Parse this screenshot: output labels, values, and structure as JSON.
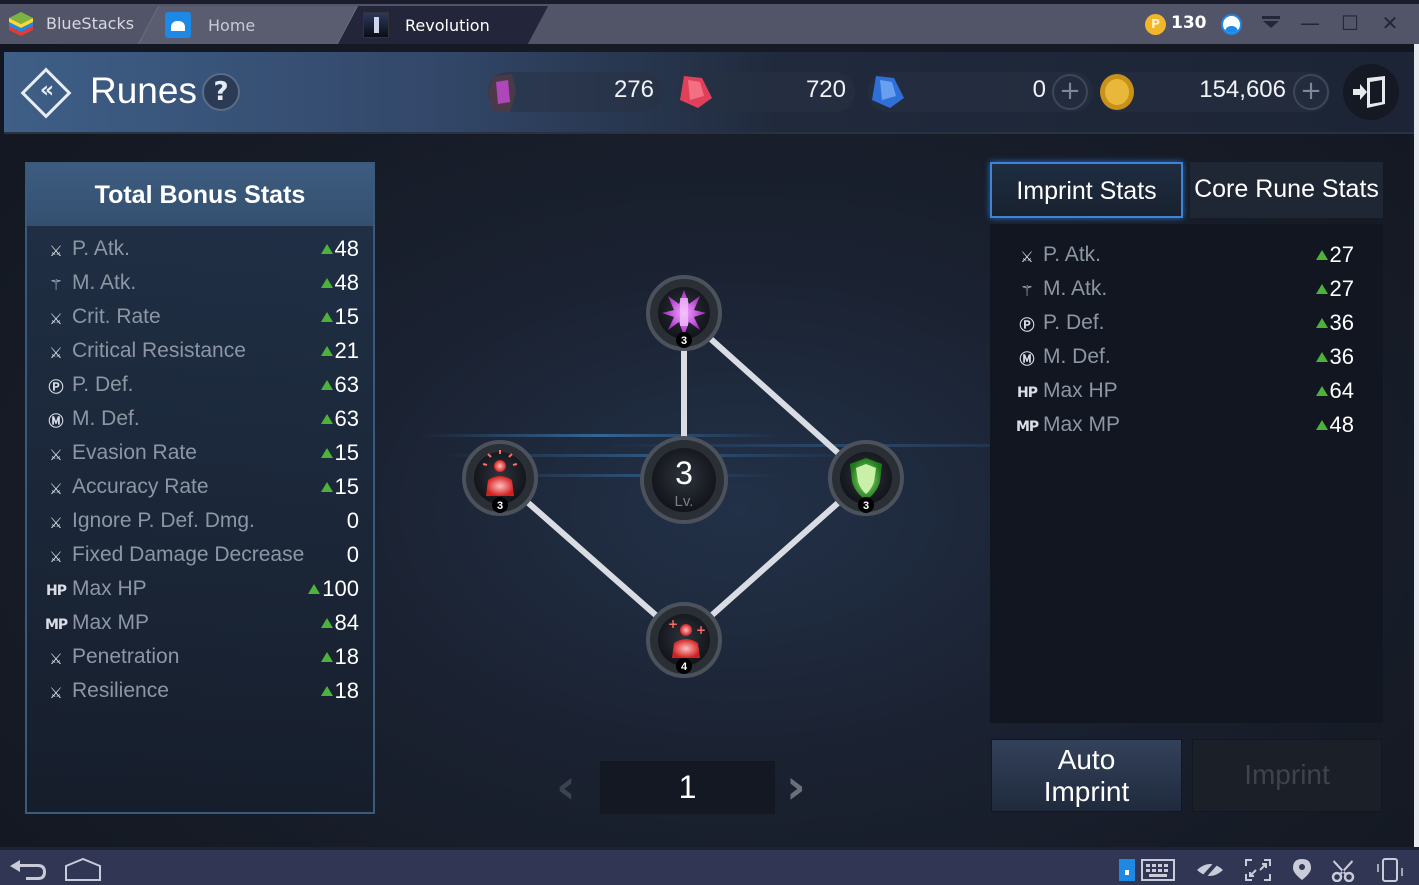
{
  "titlebar": {
    "app_name": "BlueStacks",
    "tabs": [
      {
        "label": "Home",
        "icon": "home-icon",
        "active": false
      },
      {
        "label": "Revolution",
        "icon": "game-icon",
        "active": true
      }
    ],
    "points_icon": "P",
    "points": "130",
    "window_controls": [
      "minimize",
      "maximize",
      "close"
    ],
    "minimize_glyph": "—",
    "maximize_glyph": "☐",
    "close_glyph": "✕"
  },
  "header": {
    "title": "Runes",
    "back_glyph": "«",
    "help_glyph": "?",
    "currencies": [
      {
        "name": "rune-stone",
        "value": "276",
        "color": "#c84bd8"
      },
      {
        "name": "red-gem",
        "value": "720",
        "color": "#e0405a"
      },
      {
        "name": "blue-gem",
        "value": "0",
        "color": "#3a7be0",
        "has_plus": true
      },
      {
        "name": "gold-coin",
        "value": "154,606",
        "color": "#d9a520",
        "has_plus": true
      }
    ],
    "plus_glyph": "+"
  },
  "total_bonus": {
    "title": "Total Bonus Stats",
    "stats": [
      {
        "icon": "⚔",
        "label": "P. Atk.",
        "value": "48",
        "up": true
      },
      {
        "icon": "⚚",
        "label": "M. Atk.",
        "value": "48",
        "up": true
      },
      {
        "icon": "⚔",
        "label": "Crit. Rate",
        "value": "15",
        "up": true
      },
      {
        "icon": "⚔",
        "label": "Critical Resistance",
        "value": "21",
        "up": true
      },
      {
        "icon": "Ⓟ",
        "label": "P. Def.",
        "value": "63",
        "up": true
      },
      {
        "icon": "Ⓜ",
        "label": "M. Def.",
        "value": "63",
        "up": true
      },
      {
        "icon": "⚔",
        "label": "Evasion Rate",
        "value": "15",
        "up": true
      },
      {
        "icon": "⚔",
        "label": "Accuracy Rate",
        "value": "15",
        "up": true
      },
      {
        "icon": "⚔",
        "label": "Ignore P. Def. Dmg.",
        "value": "0",
        "up": false
      },
      {
        "icon": "⚔",
        "label": "Fixed Damage Decrease",
        "value": "0",
        "up": false
      },
      {
        "icon": "HP",
        "label": "Max HP",
        "value": "100",
        "up": true
      },
      {
        "icon": "MP",
        "label": "Max MP",
        "value": "84",
        "up": true
      },
      {
        "icon": "⚔",
        "label": "Penetration",
        "value": "18",
        "up": true
      },
      {
        "icon": "⚔",
        "label": "Resilience",
        "value": "18",
        "up": true
      }
    ]
  },
  "rune_board": {
    "level": "3",
    "level_label": "Lv.",
    "nodes": [
      {
        "name": "top-rune",
        "type": "purple-crystal",
        "level": "3",
        "color": "#d04ee8"
      },
      {
        "name": "left-rune",
        "type": "red-body-glow",
        "level": "3",
        "color": "#e23b3b"
      },
      {
        "name": "right-rune",
        "type": "green-shield",
        "level": "3",
        "color": "#3fae3a"
      },
      {
        "name": "bottom-rune",
        "type": "red-body-plus",
        "level": "4",
        "color": "#e23b3b"
      }
    ]
  },
  "pager": {
    "prev_glyph": "‹",
    "next_glyph": "›",
    "page": "1"
  },
  "stats_tabs": [
    {
      "label": "Imprint Stats",
      "active": true
    },
    {
      "label": "Core Rune Stats",
      "active": false
    }
  ],
  "imprint_stats": [
    {
      "icon": "⚔",
      "label": "P. Atk.",
      "value": "27",
      "up": true
    },
    {
      "icon": "⚚",
      "label": "M. Atk.",
      "value": "27",
      "up": true
    },
    {
      "icon": "Ⓟ",
      "label": "P. Def.",
      "value": "36",
      "up": true
    },
    {
      "icon": "Ⓜ",
      "label": "M. Def.",
      "value": "36",
      "up": true
    },
    {
      "icon": "HP",
      "label": "Max HP",
      "value": "64",
      "up": true
    },
    {
      "icon": "MP",
      "label": "Max MP",
      "value": "48",
      "up": true
    }
  ],
  "actions": {
    "auto_imprint_line1": "Auto",
    "auto_imprint_line2": "Imprint",
    "imprint": "Imprint",
    "imprint_enabled": false
  },
  "navbar": {
    "left": [
      "back-icon",
      "home-icon"
    ],
    "right": [
      "phone-mode-icon",
      "keyboard-icon",
      "eye-off-icon",
      "fullscreen-icon",
      "location-icon",
      "scissors-icon",
      "shake-icon"
    ]
  },
  "colors": {
    "accent_blue": "#3f83d6",
    "stat_up_green": "#4cb23a",
    "bluestacks_tab_active": "#23263a"
  }
}
